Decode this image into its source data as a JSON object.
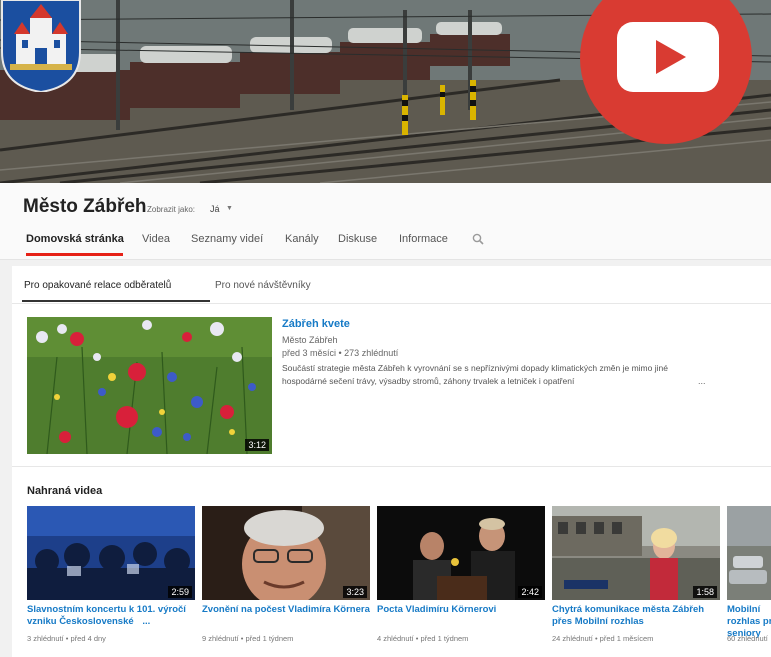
{
  "channel": {
    "title": "Město Zábřeh",
    "view_as_label": "Zobrazit jako:",
    "view_as_value": "Já"
  },
  "tabs": [
    {
      "label": "Domovská stránka",
      "active": true
    },
    {
      "label": "Videa"
    },
    {
      "label": "Seznamy videí"
    },
    {
      "label": "Kanály"
    },
    {
      "label": "Diskuse"
    },
    {
      "label": "Informace"
    }
  ],
  "subtabs": [
    {
      "label": "Pro opakované relace odběratelů",
      "active": true
    },
    {
      "label": "Pro nové návštěvníky"
    }
  ],
  "featured": {
    "title": "Zábřeh kvete",
    "channel": "Město Zábřeh",
    "meta": "před 3 měsíci • 273 zhlédnutí",
    "description": "Součástí strategie města Zábřeh k vyrovnání se s nepříznivými dopady klimatických změn je mimo jiné hospodárné sečení trávy, výsadby stromů, záhony trvalek a letniček i opatření",
    "more": "...",
    "duration": "3:12"
  },
  "uploads": {
    "title": "Nahraná videa",
    "videos": [
      {
        "title": "Slavnostním koncertu k 101. výročí vzniku Československé",
        "meta": "3 zhlédnutí • před 4 dny",
        "duration": "2:59"
      },
      {
        "title": "Zvonění na počest Vladimíra Körnera",
        "meta": "9 zhlédnutí • před 1 týdnem",
        "duration": "3:23"
      },
      {
        "title": "Pocta Vladimíru Körnerovi",
        "meta": "4 zhlédnutí • před 1 týdnem",
        "duration": "2:42"
      },
      {
        "title": "Chytrá komunikace města Zábřeh přes Mobilní rozhlas",
        "meta": "24 zhlédnutí • před 1 měsícem",
        "duration": "1:58"
      },
      {
        "title": "Mobilní rozhlas pro seniory",
        "meta": "60 zhlédnutí",
        "duration": ""
      }
    ],
    "ellipsis": "..."
  },
  "colors": {
    "accent_red": "#e62117",
    "link_blue": "#167ac6",
    "youtube_red": "#d93b32"
  }
}
